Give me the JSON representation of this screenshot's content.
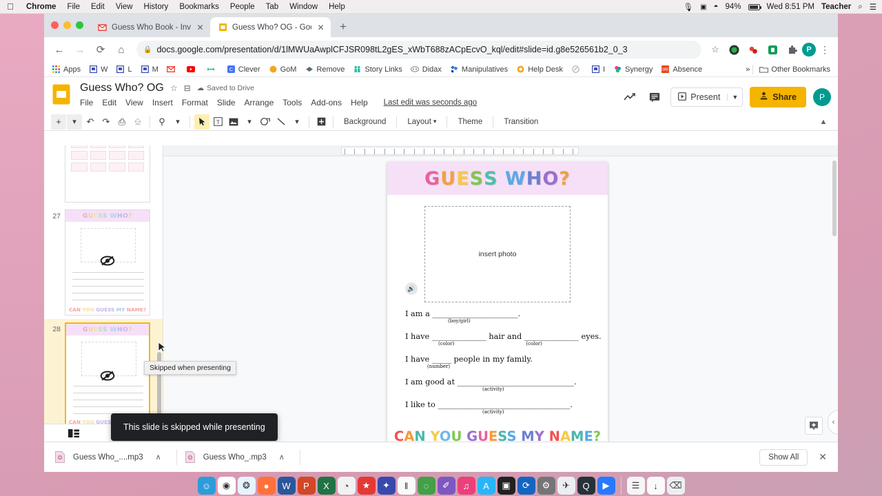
{
  "mac_menubar": {
    "apple_icon": "apple-icon",
    "items": [
      "Chrome",
      "File",
      "Edit",
      "View",
      "History",
      "Bookmarks",
      "People",
      "Tab",
      "Window",
      "Help"
    ],
    "status": {
      "mic_icon": "microphone-icon",
      "screen_icon": "screen-share-icon",
      "wifi_icon": "wifi-icon",
      "battery_pct": "94%",
      "battery_icon": "battery-icon",
      "clock": "Wed 8:51 PM",
      "user": "Teacher",
      "search_icon": "spotlight-search-icon",
      "control_icon": "control-center-icon"
    }
  },
  "browser": {
    "tabs": [
      {
        "title": "Guess Who Book - Invitation t",
        "favicon": "gmail-icon",
        "active": false
      },
      {
        "title": "Guess Who? OG - Google Slid",
        "favicon": "google-slides-icon",
        "active": true
      }
    ],
    "new_tab_label": "+",
    "nav": {
      "back": "←",
      "forward": "→",
      "reload": "⟳",
      "home": "⌂"
    },
    "address": {
      "lock_icon": "lock-icon",
      "url": "docs.google.com/presentation/d/1lMWUaAwplCFJSR098tL2gES_xWbT688zACpEcvO_kql/edit#slide=id.g8e526561b2_0_3",
      "star_icon": "bookmark-star-icon"
    },
    "extensions": [
      "extension-green-icon",
      "extension-red-icon",
      "extension-teal-icon",
      "extension-puzzle-icon"
    ],
    "profile_initial": "P",
    "menu_icon": "three-dot-menu-icon",
    "bookmarks": [
      {
        "label": "Apps",
        "icon": "apps-grid-icon"
      },
      {
        "label": "W",
        "icon": "slides-blue-icon"
      },
      {
        "label": "L",
        "icon": "slides-blue-icon"
      },
      {
        "label": "M",
        "icon": "slides-blue-icon"
      },
      {
        "label": "",
        "icon": "gmail-icon"
      },
      {
        "label": "",
        "icon": "youtube-icon"
      },
      {
        "label": "",
        "icon": "green-link-icon"
      },
      {
        "label": "Clever",
        "icon": "clever-icon"
      },
      {
        "label": "GoM",
        "icon": "orange-circle-icon"
      },
      {
        "label": "Remove",
        "icon": "diamond-icon"
      },
      {
        "label": "Story Links",
        "icon": "teal-people-icon"
      },
      {
        "label": "Didax",
        "icon": "didax-icon"
      },
      {
        "label": "Manipulatives",
        "icon": "blue-shape-icon"
      },
      {
        "label": "Help Desk",
        "icon": "lifering-icon"
      },
      {
        "label": "",
        "icon": "grey-circle-icon"
      },
      {
        "label": "I",
        "icon": "slides-blue-icon"
      },
      {
        "label": "Synergy",
        "icon": "synergy-icon"
      },
      {
        "label": "Absence",
        "icon": "absence-icon"
      }
    ],
    "overflow_label": "»",
    "other_bookmarks": {
      "label": "Other Bookmarks",
      "icon": "folder-icon"
    }
  },
  "slides_app": {
    "doc_title": "Guess Who? OG",
    "star_icon": "star-icon",
    "move_icon": "move-to-folder-icon",
    "cloud_icon": "cloud-icon",
    "save_status": "Saved to Drive",
    "menus": [
      "File",
      "Edit",
      "View",
      "Insert",
      "Format",
      "Slide",
      "Arrange",
      "Tools",
      "Add-ons",
      "Help"
    ],
    "last_edit": "Last edit was seconds ago",
    "activity_icon": "activity-chart-icon",
    "comment_icon": "comment-icon",
    "present_label": "Present",
    "present_caret": "▼",
    "share_label": "Share",
    "share_color": "#f4b400",
    "avatar_initial": "P",
    "toolbar": {
      "new_slide_icon": "new-slide-plus-icon",
      "new_slide_caret": "▾",
      "undo_icon": "undo-icon",
      "redo_icon": "redo-icon",
      "print_icon": "print-icon",
      "paint_icon": "paint-format-icon",
      "zoom_icon": "zoom-icon",
      "zoom_caret": "▾",
      "select_icon": "select-cursor-icon",
      "textbox_icon": "text-box-icon",
      "image_icon": "insert-image-icon",
      "image_caret": "▾",
      "shape_icon": "shape-icon",
      "line_icon": "line-icon",
      "line_caret": "▾",
      "comment_add_icon": "add-comment-icon",
      "background_label": "Background",
      "layout_label": "Layout",
      "layout_caret": "▾",
      "theme_label": "Theme",
      "transition_label": "Transition",
      "collapse_icon": "collapse-chevron-icon"
    }
  },
  "filmstrip": {
    "slides": [
      {
        "number": "",
        "selected": false,
        "type": "word-grid"
      },
      {
        "number": "27",
        "selected": false,
        "type": "guess-who"
      },
      {
        "number": "28",
        "selected": true,
        "type": "guess-who"
      }
    ],
    "tooltip": "Skipped when presenting",
    "view_filmstrip_icon": "filmstrip-view-icon",
    "view_grid_icon": "grid-view-icon"
  },
  "slide_content": {
    "title": "GUESS WHO?",
    "title_letters": [
      {
        "ch": "G",
        "color": "#e8639a"
      },
      {
        "ch": "U",
        "color": "#f0a23c"
      },
      {
        "ch": "E",
        "color": "#f6c94a"
      },
      {
        "ch": "S",
        "color": "#7ec850"
      },
      {
        "ch": "S",
        "color": "#4fbfa8"
      },
      {
        "ch": " ",
        "color": "#ffffff"
      },
      {
        "ch": "W",
        "color": "#5aa9e6"
      },
      {
        "ch": "H",
        "color": "#6e7fd0"
      },
      {
        "ch": "O",
        "color": "#9b6fd0"
      },
      {
        "ch": "?",
        "color": "#f2a03d"
      }
    ],
    "band_color": "#f6e0f7",
    "photo_placeholder": "insert photo",
    "audio_icon": "audio-speaker-icon",
    "lines": [
      {
        "text": "I am a ______________________.",
        "hint": "(boy/girl)",
        "hint_class": "hint-boygirl"
      },
      {
        "text": "I have ______________ hair and ______________ eyes.",
        "hints": [
          "(color)",
          "(color)"
        ]
      },
      {
        "text": "I have _____ people in my family.",
        "hint": "(number)",
        "hint_class": "hint-number"
      },
      {
        "text": "I am good at ______________________________.",
        "hint": "(activity)",
        "hint_class": "hint-activity"
      },
      {
        "text": "I like to __________________________________.",
        "hint": "(activity)",
        "hint_class": "hint-activity"
      }
    ],
    "footer": "CAN YOU GUESS MY NAME?",
    "footer_letters": [
      {
        "ch": "C",
        "color": "#ef5350"
      },
      {
        "ch": "A",
        "color": "#f49a3c"
      },
      {
        "ch": "N",
        "color": "#4db6ac"
      },
      {
        "ch": " ",
        "color": "#fff"
      },
      {
        "ch": "Y",
        "color": "#f6c94a"
      },
      {
        "ch": "O",
        "color": "#6fb9e8"
      },
      {
        "ch": "U",
        "color": "#7ec850"
      },
      {
        "ch": " ",
        "color": "#fff"
      },
      {
        "ch": "G",
        "color": "#9b6fd0"
      },
      {
        "ch": "U",
        "color": "#e8639a"
      },
      {
        "ch": "E",
        "color": "#f49a3c"
      },
      {
        "ch": "S",
        "color": "#4db6ac"
      },
      {
        "ch": "S",
        "color": "#5aa9e6"
      },
      {
        "ch": " ",
        "color": "#fff"
      },
      {
        "ch": "M",
        "color": "#6e7fd0"
      },
      {
        "ch": "Y",
        "color": "#9b6fd0"
      },
      {
        "ch": " ",
        "color": "#fff"
      },
      {
        "ch": "N",
        "color": "#ef5350"
      },
      {
        "ch": "A",
        "color": "#f6c94a"
      },
      {
        "ch": "M",
        "color": "#4db6ac"
      },
      {
        "ch": "E",
        "color": "#5aa9e6"
      },
      {
        "ch": "?",
        "color": "#7ec850"
      }
    ]
  },
  "toast": {
    "message": "This slide is skipped while presenting"
  },
  "explore": {
    "icon": "explore-icon",
    "collapse_icon": "collapse-panel-icon"
  },
  "downloads": {
    "items": [
      {
        "name": "Guess Who_....mp3",
        "icon": "mp3-file-icon",
        "caret": "∧"
      },
      {
        "name": "Guess Who_.mp3",
        "icon": "mp3-file-icon",
        "caret": "∧"
      }
    ],
    "show_all": "Show All",
    "close": "✕"
  },
  "dock": {
    "icons": [
      {
        "name": "finder-icon",
        "color": "#2d9cdb",
        "glyph": "☺",
        "running": true
      },
      {
        "name": "chrome-icon",
        "color": "#ffffff",
        "glyph": "◉",
        "running": true
      },
      {
        "name": "safari-icon",
        "color": "#e8f4fd",
        "glyph": "❂",
        "running": false
      },
      {
        "name": "firefox-icon",
        "color": "#ff7139",
        "glyph": "●",
        "running": false
      },
      {
        "name": "word-icon",
        "color": "#2b579a",
        "glyph": "W",
        "running": true
      },
      {
        "name": "powerpoint-icon",
        "color": "#d24726",
        "glyph": "P",
        "running": false
      },
      {
        "name": "excel-icon",
        "color": "#217346",
        "glyph": "X",
        "running": false
      },
      {
        "name": "speech-icon",
        "color": "#f2f2f2",
        "glyph": "◔",
        "running": false
      },
      {
        "name": "star-app-icon",
        "color": "#e53935",
        "glyph": "★",
        "running": false
      },
      {
        "name": "media-star-icon",
        "color": "#3949ab",
        "glyph": "✦",
        "running": false
      },
      {
        "name": "charts-app-icon",
        "color": "#fafafa",
        "glyph": "‖",
        "running": false
      },
      {
        "name": "globe-app-icon",
        "color": "#43a047",
        "glyph": "◌",
        "running": false
      },
      {
        "name": "notes-app-icon",
        "color": "#7e57c2",
        "glyph": "✐",
        "running": false
      },
      {
        "name": "itunes-icon",
        "color": "#ec407a",
        "glyph": "♫",
        "running": false
      },
      {
        "name": "app-store-icon",
        "color": "#29b6f6",
        "glyph": "A",
        "running": false
      },
      {
        "name": "photos-icon",
        "color": "#212121",
        "glyph": "▣",
        "running": false
      },
      {
        "name": "teamviewer-icon",
        "color": "#1565c0",
        "glyph": "⟳",
        "running": false
      },
      {
        "name": "settings-icon",
        "color": "#757575",
        "glyph": "⚙",
        "running": false
      },
      {
        "name": "launchpad-icon",
        "color": "#eceff1",
        "glyph": "✈",
        "running": false
      },
      {
        "name": "quicktime-icon",
        "color": "#263238",
        "glyph": "Q",
        "running": false
      },
      {
        "name": "facetime-icon",
        "color": "#2979ff",
        "glyph": "▶",
        "running": false
      }
    ],
    "right_icons": [
      {
        "name": "document-stack-icon",
        "color": "#f5f5f5",
        "glyph": "☰"
      },
      {
        "name": "downloads-stack-icon",
        "color": "#fafafa",
        "glyph": "↓"
      },
      {
        "name": "trash-icon",
        "color": "#eceff1",
        "glyph": "⌫"
      }
    ]
  }
}
